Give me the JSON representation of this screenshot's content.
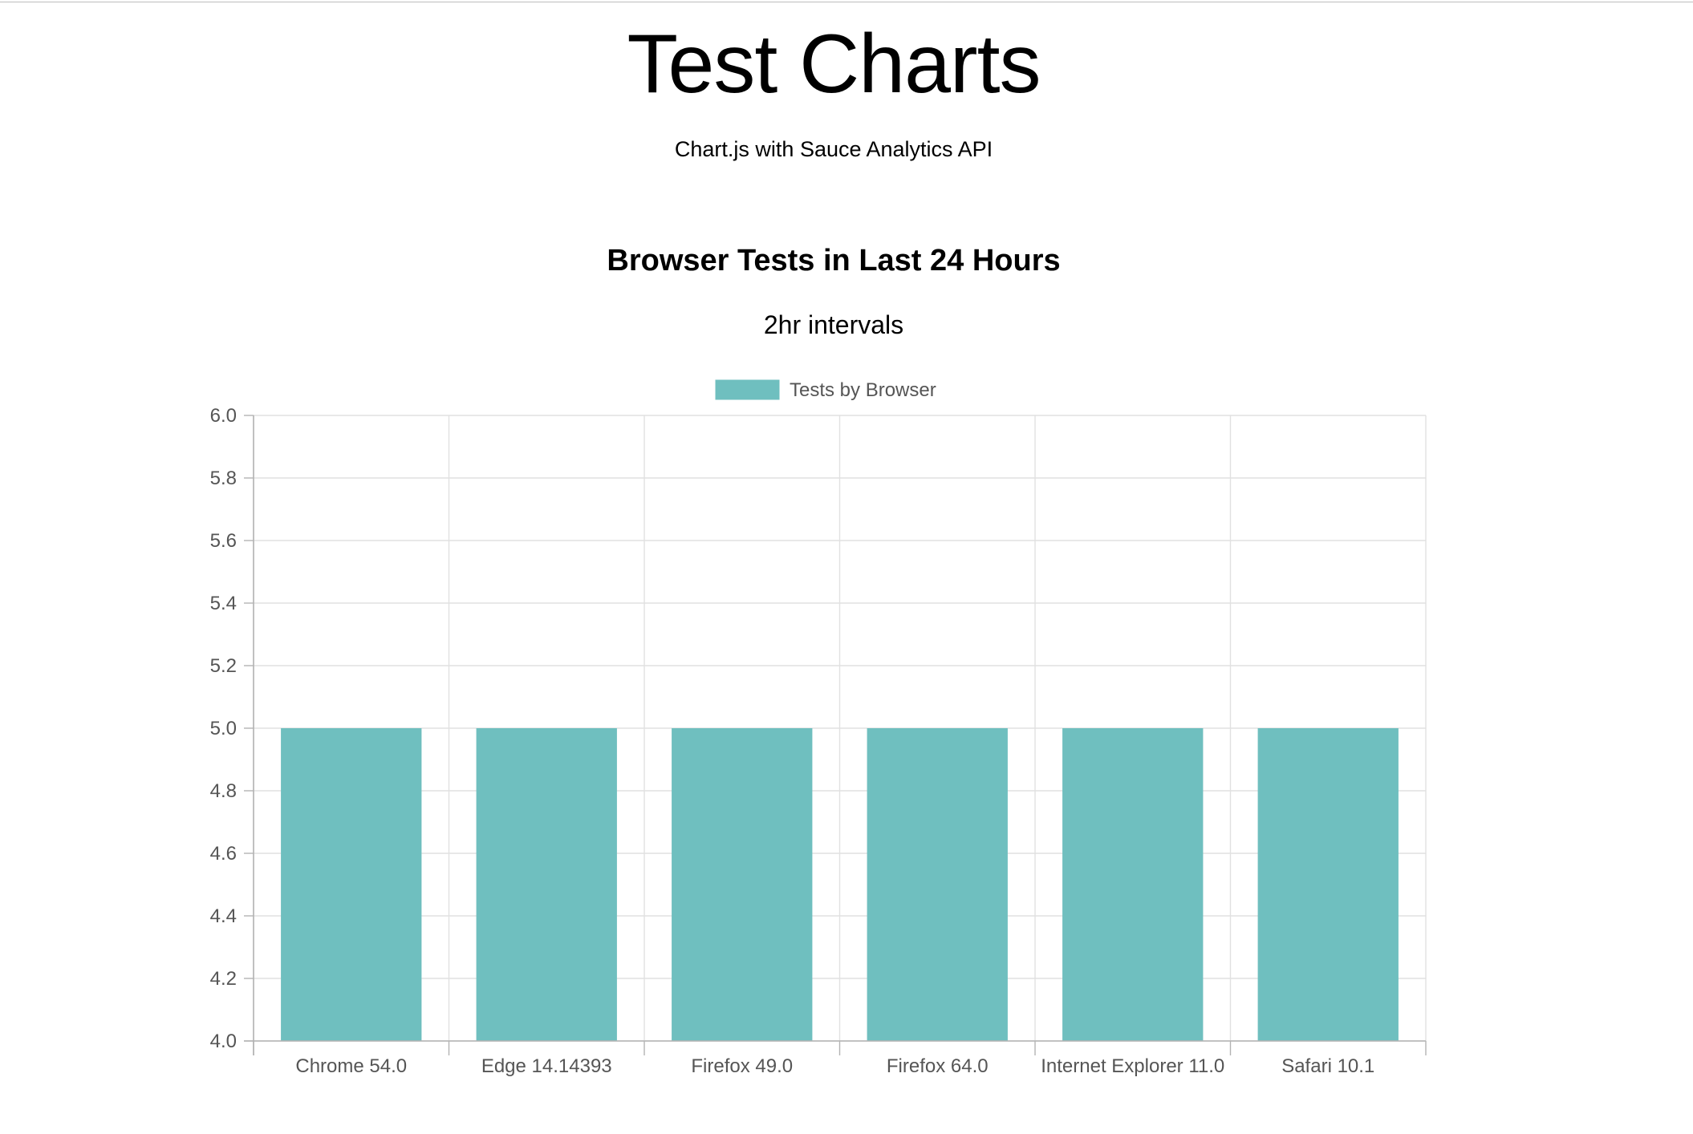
{
  "page": {
    "title": "Test Charts",
    "subtitle": "Chart.js with Sauce Analytics API"
  },
  "colors": {
    "bar_fill": "#6fbfbf",
    "grid": "#e1e1e1",
    "axis": "#b3b3b3",
    "tick_text": "#555555"
  },
  "chart_data": {
    "type": "bar",
    "title": "Browser Tests in Last 24 Hours",
    "subtitle": "2hr intervals",
    "categories": [
      "Chrome 54.0",
      "Edge 14.14393",
      "Firefox 49.0",
      "Firefox 64.0",
      "Internet Explorer 11.0",
      "Safari 10.1"
    ],
    "series": [
      {
        "name": "Tests by Browser",
        "values": [
          5,
          5,
          5,
          5,
          5,
          5
        ]
      }
    ],
    "xlabel": "",
    "ylabel": "",
    "ylim": [
      4.0,
      6.0
    ],
    "yticks": [
      "6.0",
      "5.8",
      "5.6",
      "5.4",
      "5.2",
      "5.0",
      "4.8",
      "4.6",
      "4.4",
      "4.2",
      "4.0"
    ],
    "grid": true,
    "legend": "top-center"
  }
}
